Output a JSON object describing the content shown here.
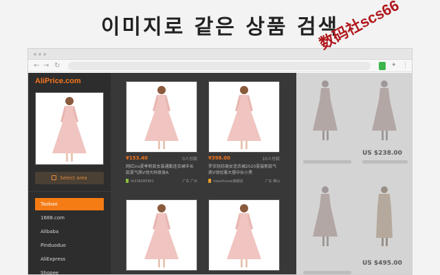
{
  "headline": "이미지로 같은 상품 검색",
  "watermark": "数码社scs66",
  "browser": {
    "nav_icons": [
      "←",
      "→",
      "↻"
    ],
    "extension_color": "#3cb54a"
  },
  "sidebar": {
    "logo": "AliPrice.com",
    "select_area_label": "Select area",
    "platforms": [
      {
        "label": "Taobao",
        "active": true
      },
      {
        "label": "1688.com",
        "active": false
      },
      {
        "label": "Alibaba",
        "active": false
      },
      {
        "label": "Pinduoduo",
        "active": false
      },
      {
        "label": "AliExpress",
        "active": false
      },
      {
        "label": "Shopee",
        "active": false
      }
    ]
  },
  "results": [
    {
      "price": "¥153.40",
      "sales": "0人付款",
      "title": "网红ins夏季新款女装通勤连衣裙中长款夏气质V领大码修身A",
      "shop": "tb338285961",
      "location": "广东 广州"
    },
    {
      "price": "¥398.00",
      "sales": "10人付款",
      "title": "罗衣轻纺瑜女连衣裙2020夏装新款气质V领优雅大摆中长小黑",
      "shop": "roeyshouse旗舰店",
      "location": "广东 佛山"
    },
    {
      "price": "",
      "sales": "",
      "title": "",
      "shop": "",
      "location": ""
    },
    {
      "price": "",
      "sales": "",
      "title": "",
      "shop": "",
      "location": ""
    }
  ],
  "background_page": {
    "prices": [
      "US $238.00",
      "US $495.00"
    ]
  },
  "colors": {
    "accent": "#f57b14",
    "panel_dark": "#2d2d2d",
    "results_bg": "#383838",
    "dress_pink": "#f0c4c0"
  }
}
